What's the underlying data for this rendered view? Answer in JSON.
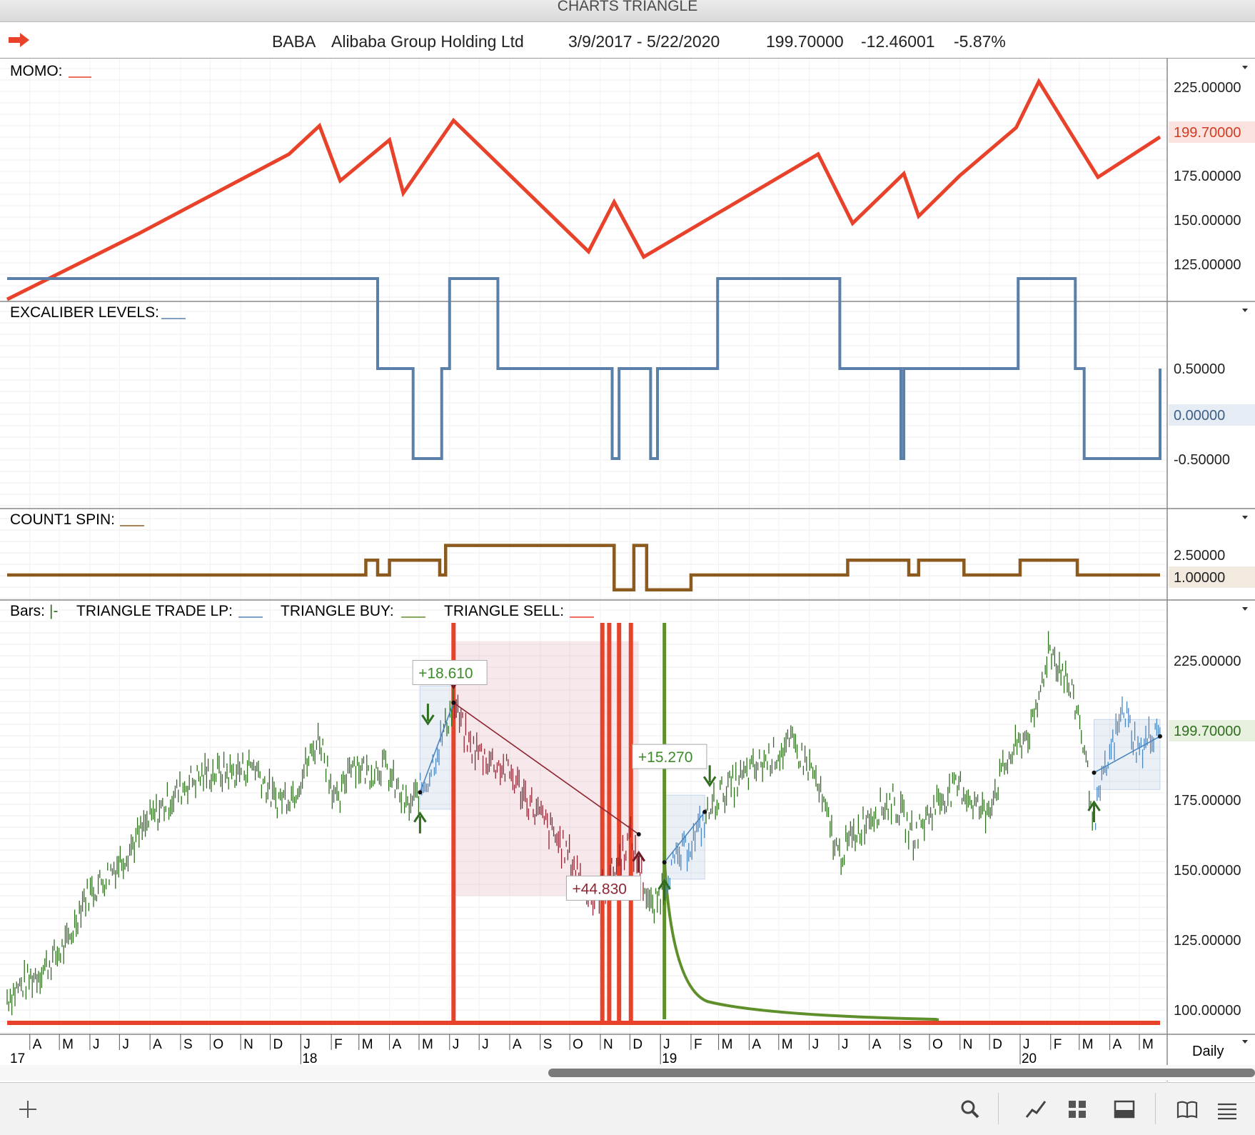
{
  "window": {
    "title": "CHARTS TRIANGLE"
  },
  "info": {
    "symbol": "BABA",
    "name": "Alibaba Group Holding Ltd",
    "range": "3/9/2017 - 5/22/2020",
    "last": "199.70000",
    "change": "-12.46001",
    "change_pct": "-5.87%"
  },
  "colors": {
    "momo": "#e8422a",
    "excal": "#5a7fa8",
    "spin": "#8c5a1e",
    "up": "#2f6e1f",
    "down": "#8f2432",
    "buy": "#5f8f2a",
    "sell": "#e8422a",
    "trade": "#4a86c0"
  },
  "panels": {
    "momo": {
      "label": "MOMO:",
      "ticks": [
        "225.00000",
        "175.00000",
        "150.00000",
        "125.00000"
      ],
      "current": "199.70000"
    },
    "excal": {
      "label": "EXCALIBER LEVELS:",
      "ticks": [
        "0.50000",
        "-0.50000"
      ],
      "current": "0.00000"
    },
    "spin": {
      "label": "COUNT1 SPIN:",
      "ticks": [
        "2.50000"
      ],
      "current": "1.00000"
    },
    "price": {
      "legend_bars": "Bars:",
      "legend_bars_sym": "|-",
      "legend_trade": "TRIANGLE TRADE LP:",
      "legend_buy": "TRIANGLE BUY:",
      "legend_sell": "TRIANGLE SELL:",
      "ticks": [
        "225.00000",
        "175.00000",
        "150.00000",
        "125.00000",
        "100.00000"
      ],
      "current": "199.70000",
      "annotations": [
        "+18.610",
        "+15.270",
        "+44.830"
      ]
    }
  },
  "series": {
    "momo": {
      "x": [
        "2017-03-09",
        "2017-07-20",
        "2017-12-20",
        "2018-01-20",
        "2018-02-10",
        "2018-04-01",
        "2018-04-15",
        "2018-06-05",
        "2018-10-20",
        "2018-11-15",
        "2018-12-15",
        "2019-06-10",
        "2019-07-15",
        "2019-09-05",
        "2019-09-20",
        "2019-11-01",
        "2019-12-28",
        "2020-01-20",
        "2020-03-20",
        "2020-05-22"
      ],
      "y": [
        108,
        145,
        190,
        206,
        175,
        198,
        168,
        209,
        135,
        163,
        132,
        190,
        151,
        179,
        155,
        178,
        205,
        231,
        177,
        199.7
      ]
    },
    "excal": {
      "x": [
        "2017-03-09",
        "2017-12-15",
        "2018-01-10",
        "2018-03-20",
        "2018-04-25",
        "2018-04-28",
        "2018-05-24",
        "2018-06-01",
        "2018-07-20",
        "2018-11-13",
        "2018-11-20",
        "2018-12-22",
        "2018-12-29",
        "2019-02-28",
        "2019-07-02",
        "2019-09-02",
        "2019-09-05",
        "2019-09-25",
        "2019-12-30",
        "2020-02-26",
        "2020-03-06",
        "2020-05-22"
      ],
      "y": [
        1,
        1,
        1,
        0,
        -1,
        -1,
        0,
        1,
        0,
        -1,
        0,
        -1,
        0,
        1,
        0,
        -1,
        0,
        0,
        1,
        0,
        -1,
        0
      ]
    },
    "spin": {
      "x": [
        "2017-03-09",
        "2018-01-25",
        "2018-03-08",
        "2018-03-20",
        "2018-04-01",
        "2018-04-25",
        "2018-05-22",
        "2018-05-28",
        "2018-10-10",
        "2018-11-15",
        "2018-12-05",
        "2018-12-18",
        "2019-02-01",
        "2019-07-01",
        "2019-07-10",
        "2019-09-10",
        "2019-09-20",
        "2019-11-05",
        "2019-12-27",
        "2020-01-01",
        "2020-02-28",
        "2020-05-22"
      ],
      "y": [
        1,
        1,
        2,
        1,
        2,
        2,
        1,
        3,
        3,
        0,
        3,
        0,
        1,
        1,
        2,
        1,
        2,
        1,
        1,
        2,
        1,
        1
      ]
    },
    "price": {
      "x": [
        "2017-03-09",
        "2017-04-15",
        "2017-05-10",
        "2017-05-25",
        "2017-06-10",
        "2017-07-05",
        "2017-08-01",
        "2017-08-20",
        "2017-09-10",
        "2017-10-01",
        "2017-10-25",
        "2017-11-15",
        "2017-12-05",
        "2017-12-25",
        "2018-01-20",
        "2018-02-08",
        "2018-02-20",
        "2018-03-10",
        "2018-03-25",
        "2018-04-20",
        "2018-05-10",
        "2018-06-05",
        "2018-06-20",
        "2018-07-10",
        "2018-08-01",
        "2018-08-20",
        "2018-09-10",
        "2018-10-01",
        "2018-10-25",
        "2018-11-15",
        "2018-12-01",
        "2018-12-24",
        "2019-01-10",
        "2019-02-05",
        "2019-03-01",
        "2019-03-25",
        "2019-04-20",
        "2019-05-15",
        "2019-06-05",
        "2019-07-01",
        "2019-08-01",
        "2019-08-25",
        "2019-09-15",
        "2019-10-10",
        "2019-11-01",
        "2019-11-26",
        "2019-12-20",
        "2020-01-15",
        "2020-01-30",
        "2020-02-15",
        "2020-03-01",
        "2020-03-16",
        "2020-03-25",
        "2020-04-15",
        "2020-05-01",
        "2020-05-22"
      ],
      "y": [
        105,
        115,
        124,
        140,
        145,
        155,
        168,
        175,
        182,
        185,
        185,
        188,
        175,
        178,
        198,
        172,
        190,
        185,
        188,
        172,
        183,
        210,
        195,
        190,
        185,
        175,
        165,
        155,
        140,
        150,
        162,
        135,
        150,
        162,
        177,
        183,
        190,
        195,
        185,
        155,
        170,
        175,
        162,
        175,
        180,
        170,
        190,
        202,
        230,
        220,
        205,
        168,
        182,
        208,
        192,
        203
      ]
    },
    "sell_spikes": [
      "2018-06-05",
      "2018-11-03",
      "2018-11-10",
      "2018-11-20",
      "2018-12-02"
    ],
    "buy_spike": "2019-01-05"
  },
  "trades": [
    {
      "entry_date": "2018-05-02",
      "exit_date": "2018-06-05",
      "entry": 178,
      "exit": 210,
      "result": "+18.610",
      "type": "long"
    },
    {
      "entry_date": "2018-06-05",
      "exit_date": "2018-12-10",
      "entry": 210,
      "exit": 163,
      "result": "+44.830",
      "type": "short"
    },
    {
      "entry_date": "2019-01-05",
      "exit_date": "2019-02-15",
      "entry": 153,
      "exit": 171,
      "result": "+15.270",
      "type": "long"
    },
    {
      "entry_date": "2020-03-16",
      "exit_date": "2020-05-22",
      "entry": 185,
      "exit": 198,
      "result": "",
      "type": "long"
    }
  ],
  "timeaxis": {
    "months": [
      {
        "l": "A",
        "d": "2017-04-01"
      },
      {
        "l": "M",
        "d": "2017-05-01"
      },
      {
        "l": "J",
        "d": "2017-06-01"
      },
      {
        "l": "J",
        "d": "2017-07-01"
      },
      {
        "l": "A",
        "d": "2017-08-01"
      },
      {
        "l": "S",
        "d": "2017-09-01"
      },
      {
        "l": "O",
        "d": "2017-10-01"
      },
      {
        "l": "N",
        "d": "2017-11-01"
      },
      {
        "l": "D",
        "d": "2017-12-01"
      },
      {
        "l": "J",
        "d": "2018-01-01"
      },
      {
        "l": "F",
        "d": "2018-02-01"
      },
      {
        "l": "M",
        "d": "2018-03-01"
      },
      {
        "l": "A",
        "d": "2018-04-01"
      },
      {
        "l": "M",
        "d": "2018-05-01"
      },
      {
        "l": "J",
        "d": "2018-06-01"
      },
      {
        "l": "J",
        "d": "2018-07-01"
      },
      {
        "l": "A",
        "d": "2018-08-01"
      },
      {
        "l": "S",
        "d": "2018-09-01"
      },
      {
        "l": "O",
        "d": "2018-10-01"
      },
      {
        "l": "N",
        "d": "2018-11-01"
      },
      {
        "l": "D",
        "d": "2018-12-01"
      },
      {
        "l": "J",
        "d": "2019-01-01"
      },
      {
        "l": "F",
        "d": "2019-02-01"
      },
      {
        "l": "M",
        "d": "2019-03-01"
      },
      {
        "l": "A",
        "d": "2019-04-01"
      },
      {
        "l": "M",
        "d": "2019-05-01"
      },
      {
        "l": "J",
        "d": "2019-06-01"
      },
      {
        "l": "J",
        "d": "2019-07-01"
      },
      {
        "l": "A",
        "d": "2019-08-01"
      },
      {
        "l": "S",
        "d": "2019-09-01"
      },
      {
        "l": "O",
        "d": "2019-10-01"
      },
      {
        "l": "N",
        "d": "2019-11-01"
      },
      {
        "l": "D",
        "d": "2019-12-01"
      },
      {
        "l": "J",
        "d": "2020-01-01"
      },
      {
        "l": "F",
        "d": "2020-02-01"
      },
      {
        "l": "M",
        "d": "2020-03-01"
      },
      {
        "l": "A",
        "d": "2020-04-01"
      },
      {
        "l": "M",
        "d": "2020-05-01"
      }
    ],
    "years": [
      {
        "l": "17",
        "d": "2017-03-09"
      },
      {
        "l": "18",
        "d": "2018-01-01"
      },
      {
        "l": "19",
        "d": "2019-01-01"
      },
      {
        "l": "20",
        "d": "2020-01-01"
      }
    ],
    "interval": "Daily"
  },
  "toolbar": {
    "icons": [
      "plus-icon",
      "search-icon",
      "line-chart-icon",
      "grid-icon",
      "panel-icon",
      "book-icon",
      "menu-icon"
    ]
  }
}
